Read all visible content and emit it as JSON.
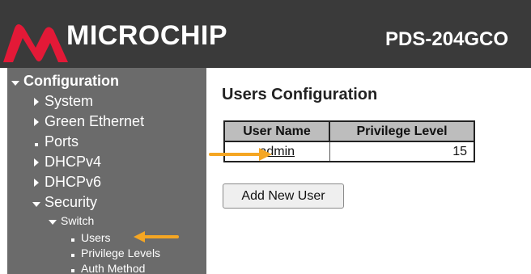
{
  "header": {
    "brand": "MICROCHIP",
    "product": "PDS-204GCO",
    "brand_color": "#e31937"
  },
  "sidebar": {
    "items": [
      {
        "label": "Configuration",
        "icon": "caret-down-icon"
      },
      {
        "label": "System",
        "icon": "caret-right-icon"
      },
      {
        "label": "Green Ethernet",
        "icon": "caret-right-icon"
      },
      {
        "label": "Ports",
        "icon": "bullet-icon"
      },
      {
        "label": "DHCPv4",
        "icon": "caret-right-icon"
      },
      {
        "label": "DHCPv6",
        "icon": "caret-right-icon"
      },
      {
        "label": "Security",
        "icon": "caret-down-icon"
      },
      {
        "label": "Switch",
        "icon": "caret-down-icon"
      },
      {
        "label": "Users",
        "icon": "bullet-icon"
      },
      {
        "label": "Privilege Levels",
        "icon": "bullet-icon"
      },
      {
        "label": "Auth Method",
        "icon": "bullet-icon"
      }
    ]
  },
  "main": {
    "title": "Users Configuration",
    "table": {
      "headers": [
        "User Name",
        "Privilege Level"
      ],
      "rows": [
        {
          "name": "admin",
          "level": "15"
        }
      ]
    },
    "add_button": "Add New User"
  },
  "annotations": {
    "arrow_color": "#f5a623"
  }
}
